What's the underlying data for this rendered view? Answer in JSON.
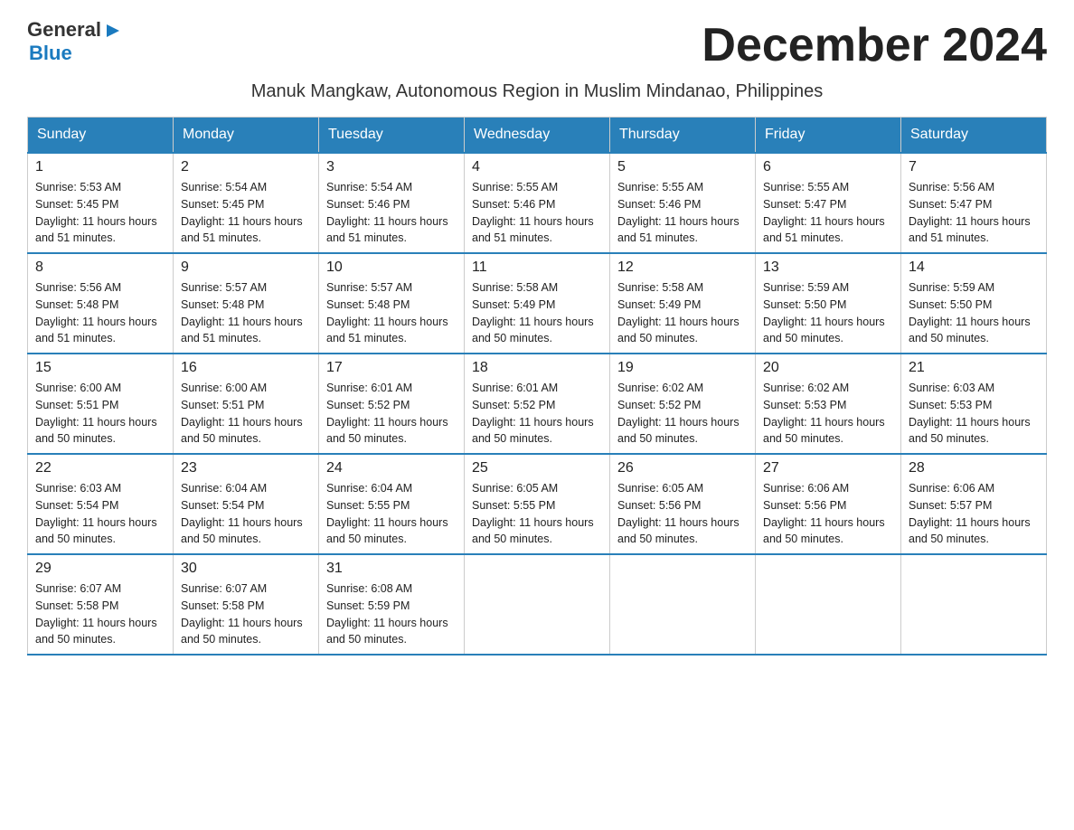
{
  "logo": {
    "text_general": "General",
    "triangle_char": "▶",
    "text_blue": "Blue"
  },
  "header": {
    "title": "December 2024"
  },
  "subtitle": "Manuk Mangkaw, Autonomous Region in Muslim Mindanao, Philippines",
  "days_of_week": [
    "Sunday",
    "Monday",
    "Tuesday",
    "Wednesday",
    "Thursday",
    "Friday",
    "Saturday"
  ],
  "weeks": [
    [
      {
        "day": "1",
        "sunrise": "5:53 AM",
        "sunset": "5:45 PM",
        "daylight": "11 hours and 51 minutes."
      },
      {
        "day": "2",
        "sunrise": "5:54 AM",
        "sunset": "5:45 PM",
        "daylight": "11 hours and 51 minutes."
      },
      {
        "day": "3",
        "sunrise": "5:54 AM",
        "sunset": "5:46 PM",
        "daylight": "11 hours and 51 minutes."
      },
      {
        "day": "4",
        "sunrise": "5:55 AM",
        "sunset": "5:46 PM",
        "daylight": "11 hours and 51 minutes."
      },
      {
        "day": "5",
        "sunrise": "5:55 AM",
        "sunset": "5:46 PM",
        "daylight": "11 hours and 51 minutes."
      },
      {
        "day": "6",
        "sunrise": "5:55 AM",
        "sunset": "5:47 PM",
        "daylight": "11 hours and 51 minutes."
      },
      {
        "day": "7",
        "sunrise": "5:56 AM",
        "sunset": "5:47 PM",
        "daylight": "11 hours and 51 minutes."
      }
    ],
    [
      {
        "day": "8",
        "sunrise": "5:56 AM",
        "sunset": "5:48 PM",
        "daylight": "11 hours and 51 minutes."
      },
      {
        "day": "9",
        "sunrise": "5:57 AM",
        "sunset": "5:48 PM",
        "daylight": "11 hours and 51 minutes."
      },
      {
        "day": "10",
        "sunrise": "5:57 AM",
        "sunset": "5:48 PM",
        "daylight": "11 hours and 51 minutes."
      },
      {
        "day": "11",
        "sunrise": "5:58 AM",
        "sunset": "5:49 PM",
        "daylight": "11 hours and 50 minutes."
      },
      {
        "day": "12",
        "sunrise": "5:58 AM",
        "sunset": "5:49 PM",
        "daylight": "11 hours and 50 minutes."
      },
      {
        "day": "13",
        "sunrise": "5:59 AM",
        "sunset": "5:50 PM",
        "daylight": "11 hours and 50 minutes."
      },
      {
        "day": "14",
        "sunrise": "5:59 AM",
        "sunset": "5:50 PM",
        "daylight": "11 hours and 50 minutes."
      }
    ],
    [
      {
        "day": "15",
        "sunrise": "6:00 AM",
        "sunset": "5:51 PM",
        "daylight": "11 hours and 50 minutes."
      },
      {
        "day": "16",
        "sunrise": "6:00 AM",
        "sunset": "5:51 PM",
        "daylight": "11 hours and 50 minutes."
      },
      {
        "day": "17",
        "sunrise": "6:01 AM",
        "sunset": "5:52 PM",
        "daylight": "11 hours and 50 minutes."
      },
      {
        "day": "18",
        "sunrise": "6:01 AM",
        "sunset": "5:52 PM",
        "daylight": "11 hours and 50 minutes."
      },
      {
        "day": "19",
        "sunrise": "6:02 AM",
        "sunset": "5:52 PM",
        "daylight": "11 hours and 50 minutes."
      },
      {
        "day": "20",
        "sunrise": "6:02 AM",
        "sunset": "5:53 PM",
        "daylight": "11 hours and 50 minutes."
      },
      {
        "day": "21",
        "sunrise": "6:03 AM",
        "sunset": "5:53 PM",
        "daylight": "11 hours and 50 minutes."
      }
    ],
    [
      {
        "day": "22",
        "sunrise": "6:03 AM",
        "sunset": "5:54 PM",
        "daylight": "11 hours and 50 minutes."
      },
      {
        "day": "23",
        "sunrise": "6:04 AM",
        "sunset": "5:54 PM",
        "daylight": "11 hours and 50 minutes."
      },
      {
        "day": "24",
        "sunrise": "6:04 AM",
        "sunset": "5:55 PM",
        "daylight": "11 hours and 50 minutes."
      },
      {
        "day": "25",
        "sunrise": "6:05 AM",
        "sunset": "5:55 PM",
        "daylight": "11 hours and 50 minutes."
      },
      {
        "day": "26",
        "sunrise": "6:05 AM",
        "sunset": "5:56 PM",
        "daylight": "11 hours and 50 minutes."
      },
      {
        "day": "27",
        "sunrise": "6:06 AM",
        "sunset": "5:56 PM",
        "daylight": "11 hours and 50 minutes."
      },
      {
        "day": "28",
        "sunrise": "6:06 AM",
        "sunset": "5:57 PM",
        "daylight": "11 hours and 50 minutes."
      }
    ],
    [
      {
        "day": "29",
        "sunrise": "6:07 AM",
        "sunset": "5:58 PM",
        "daylight": "11 hours and 50 minutes."
      },
      {
        "day": "30",
        "sunrise": "6:07 AM",
        "sunset": "5:58 PM",
        "daylight": "11 hours and 50 minutes."
      },
      {
        "day": "31",
        "sunrise": "6:08 AM",
        "sunset": "5:59 PM",
        "daylight": "11 hours and 50 minutes."
      },
      null,
      null,
      null,
      null
    ]
  ],
  "labels": {
    "sunrise": "Sunrise:",
    "sunset": "Sunset:",
    "daylight": "Daylight:"
  }
}
